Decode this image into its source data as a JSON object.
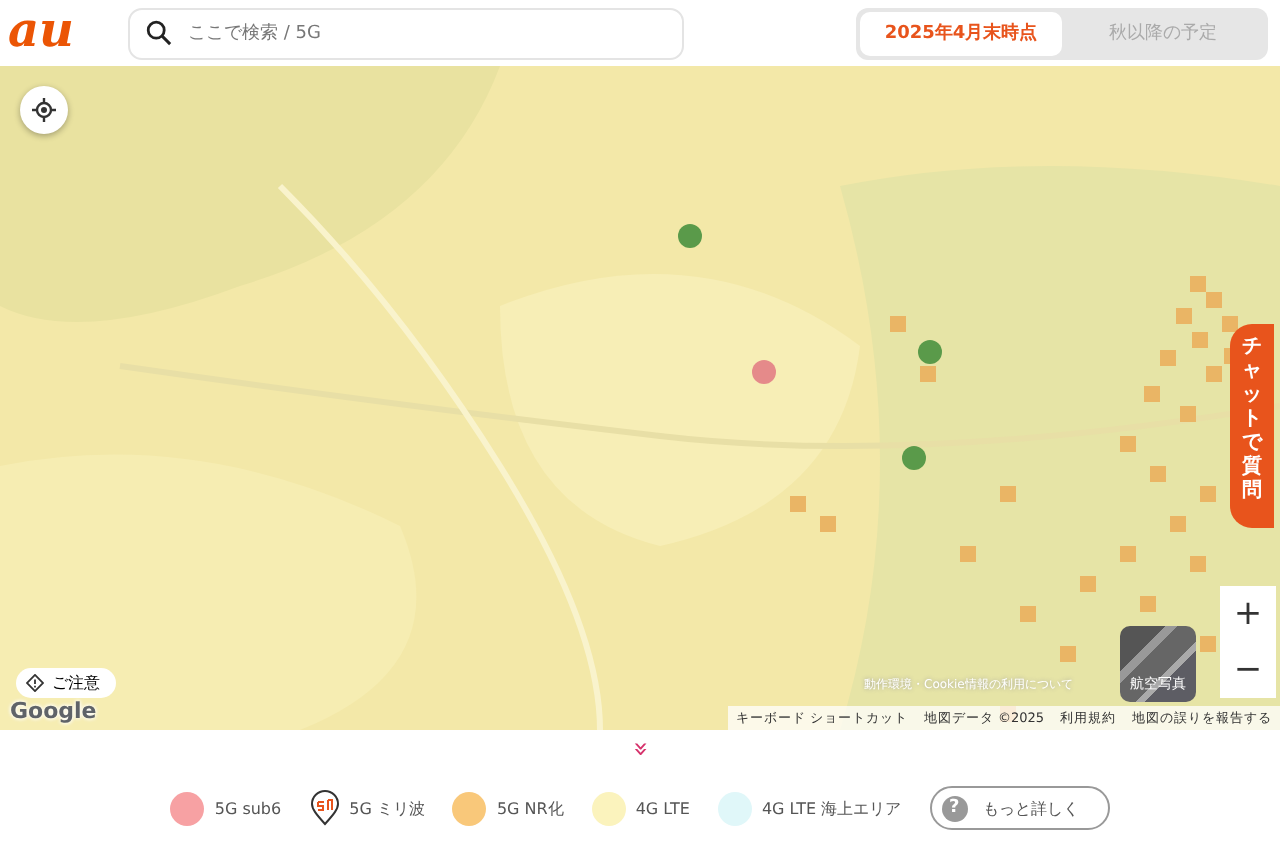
{
  "logo": "au",
  "search": {
    "placeholder": "ここで検索 / 5G"
  },
  "tabs": [
    {
      "label": "2025年4月末時点",
      "selected": true
    },
    {
      "label": "秋以降の予定",
      "selected": false
    }
  ],
  "map": {
    "kind": "picture",
    "notice": "ご注意",
    "google": "Google",
    "env_note": "動作環境・Cookie情報の利用について",
    "aerial": "航空写真",
    "zoom_in": "+",
    "zoom_out": "−",
    "chat": "チャットで質問",
    "attribution": [
      "キーボード ショートカット",
      "地図データ ©2025",
      "利用規約",
      "地図の誤りを報告する"
    ]
  },
  "expand": "»",
  "legend": [
    {
      "kind": "dot",
      "color": "#f7a1a3",
      "label": "5G sub6"
    },
    {
      "kind": "pin",
      "label": "5G ミリ波"
    },
    {
      "kind": "dot",
      "color": "#f9c87a",
      "label": "5G NR化"
    },
    {
      "kind": "dot",
      "color": "#fbf3bd",
      "label": "4G LTE"
    },
    {
      "kind": "dot",
      "color": "#e0f7f9",
      "label": "4G LTE 海上エリア"
    }
  ],
  "more_button": {
    "icon": "?",
    "label": "もっと詳しく"
  }
}
